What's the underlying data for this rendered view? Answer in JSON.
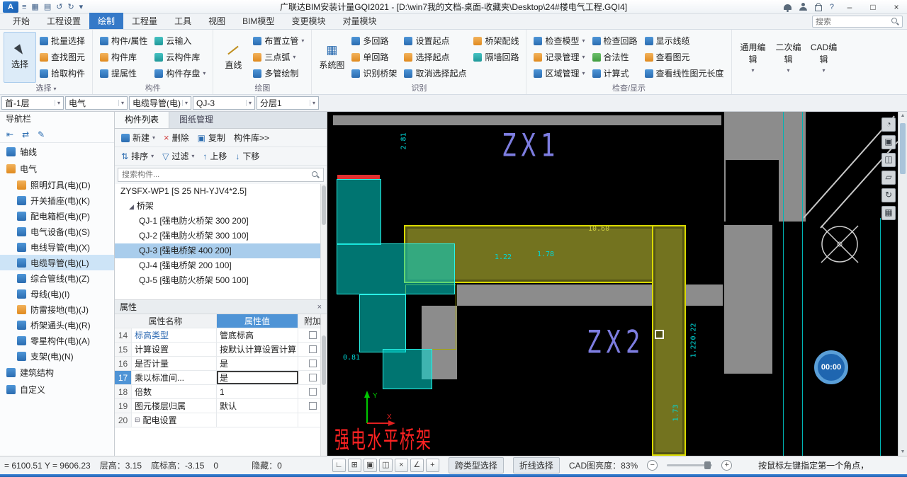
{
  "titlebar": {
    "title": "广联达BIM安装计量GQI2021 - [D:\\win7我的文档-桌面-收藏夹\\Desktop\\24#楼电气工程.GQI4]"
  },
  "tabbar": {
    "tabs": [
      "开始",
      "工程设置",
      "绘制",
      "工程量",
      "工具",
      "视图",
      "BIM模型",
      "变更模块",
      "对量模块"
    ],
    "search_placeholder": "搜索"
  },
  "ribbon": {
    "big_select": "选择",
    "select_items": [
      "批量选择",
      "查找图元",
      "拾取构件"
    ],
    "group_select": "选择",
    "comp_col1": [
      "构件/属性",
      "构件库",
      "提属性"
    ],
    "comp_col2": [
      "云输入",
      "云构件库",
      "构件存盘"
    ],
    "group_comp": "构件",
    "big_line": "直线",
    "draw_col": [
      "布置立管",
      "三点弧",
      "多管绘制"
    ],
    "group_draw": "绘图",
    "big_system": "系统图",
    "ident_col1": [
      "多回路",
      "单回路",
      "识别桥架"
    ],
    "ident_col2": [
      "设置起点",
      "选择起点",
      "取消选择起点"
    ],
    "ident_col3": [
      "桥架配线",
      "隔墙回路"
    ],
    "group_ident": "识别",
    "check_col1": [
      "检查模型",
      "记录管理",
      "区域管理"
    ],
    "check_col2": [
      "检查回路",
      "合法性",
      "计算式"
    ],
    "check_col3": [
      "显示线缆",
      "查看图元",
      "查看线性图元长度"
    ],
    "group_check": "检查/显示",
    "edit_buttons": [
      "通用编辑",
      "二次编辑",
      "CAD编辑"
    ]
  },
  "filterbar": {
    "dropdowns": [
      "首-1层",
      "电气",
      "电缆导管(电)",
      "QJ-3",
      "分层1"
    ]
  },
  "nav": {
    "title": "导航栏",
    "top_items": [
      "轴线",
      "电气"
    ],
    "children": [
      "照明灯具(电)(D)",
      "开关插座(电)(K)",
      "配电箱柜(电)(P)",
      "电气设备(电)(S)",
      "电线导管(电)(X)",
      "电缆导管(电)(L)",
      "综合管线(电)(Z)",
      "母线(电)(I)",
      "防雷接地(电)(J)",
      "桥架通头(电)(R)",
      "零星构件(电)(A)",
      "支架(电)(N)"
    ],
    "bottom_items": [
      "建筑结构",
      "自定义"
    ]
  },
  "panel": {
    "tabs": [
      "构件列表",
      "图纸管理"
    ],
    "toolbar1": [
      "新建",
      "删除",
      "复制",
      "构件库>>"
    ],
    "toolbar2": [
      "排序",
      "过滤",
      "上移",
      "下移"
    ],
    "search_placeholder": "搜索构件...",
    "root_item": "ZYSFX-WP1 [S 25 NH-YJV4*2.5]",
    "group_item": "桥架",
    "items": [
      "QJ-1 [强电防火桥架 300 200]",
      "QJ-2 [强电防火桥架 300 100]",
      "QJ-3 [强电桥架 400 200]",
      "QJ-4 [强电桥架 200 100]",
      "QJ-5 [强电防火桥架 500 100]"
    ]
  },
  "props": {
    "title": "属性",
    "headers": {
      "name": "属性名称",
      "value": "属性值",
      "attach": "附加"
    },
    "rows": [
      {
        "num": "14",
        "name": "标高类型",
        "value": "管底标高"
      },
      {
        "num": "15",
        "name": "计算设置",
        "value": "按默认计算设置计算"
      },
      {
        "num": "16",
        "name": "是否计量",
        "value": "是"
      },
      {
        "num": "17",
        "name": "乘以标准间...",
        "value": "是"
      },
      {
        "num": "18",
        "name": "倍数",
        "value": "1"
      },
      {
        "num": "19",
        "name": "图元楼层归属",
        "value": "默认"
      },
      {
        "num": "20",
        "name": "配电设置",
        "value": ""
      }
    ]
  },
  "cad": {
    "label_zx1": "ZX1",
    "label_zx2": "ZX2",
    "label_red": "强电水平桥架",
    "axis_x": "X",
    "axis_y": "Y",
    "timer": "00:00",
    "dims": [
      {
        "text": "2.81"
      },
      {
        "text": "1.22"
      },
      {
        "text": "1.78"
      },
      {
        "text": "10.60"
      },
      {
        "text": "0.81"
      },
      {
        "text": "0.22"
      },
      {
        "text": "1.22"
      },
      {
        "text": "1.73"
      }
    ]
  },
  "statusbar": {
    "coords": "= 6100.51 Y = 9606.23",
    "floor_height": "层高：3.15",
    "bottom_elevation": "底标高：-3.15",
    "count": "0",
    "hidden": "隐藏：0",
    "cross_type_select": "跨类型选择",
    "polyline_select": "折线选择",
    "brightness": "CAD图亮度：83%",
    "hint": "按鼠标左键指定第一个角点，"
  },
  "icons": {
    "dropdown": "▾",
    "menu": "≡",
    "save": "▤",
    "undo": "↺",
    "redo": "↻",
    "grid": "▦",
    "help": "?",
    "min": "–",
    "max": "□",
    "close": "×",
    "expand": "◢",
    "collapse": "⊟",
    "sort": "⇅",
    "filter": "▽",
    "up": "↑",
    "down": "↓",
    "delete": "×",
    "copy": "▣",
    "new": "▢",
    "back": "⇤",
    "swap": "⇄",
    "edit": "✎",
    "ortho": "∟",
    "snapgrid": "⊞",
    "cube": "▣",
    "section": "◫",
    "erase": "×",
    "angle": "∠",
    "snap": "+",
    "orbit": "◔",
    "viewplane": "▱",
    "rotate": "↻",
    "minus": "−",
    "plus": "+",
    "scroll_up": "▲",
    "scroll_down": "▼"
  },
  "colors": {
    "accent": "#3579c8",
    "selection": "#a9cdec",
    "tray_fill": "#73731f",
    "tray_border": "#d9d900",
    "cad_cyan": "#00d8d8",
    "cad_purple": "#7d7de0",
    "cad_red": "#ff2222"
  }
}
